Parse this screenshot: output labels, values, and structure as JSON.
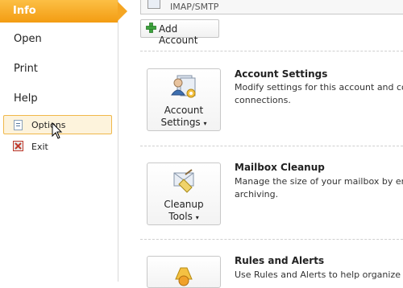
{
  "nav": {
    "info": "Info",
    "open": "Open",
    "print": "Print",
    "help": "Help",
    "options": "Options",
    "exit": "Exit"
  },
  "account": {
    "type_label": "IMAP/SMTP",
    "add_account": "Add Account"
  },
  "sections": [
    {
      "button_line1": "Account",
      "button_line2": "Settings",
      "title": "Account Settings",
      "desc_line1": "Modify settings for this account and conf",
      "desc_line2": "connections."
    },
    {
      "button_line1": "Cleanup",
      "button_line2": "Tools",
      "title": "Mailbox Cleanup",
      "desc_line1": "Manage the size of your mailbox by empt",
      "desc_line2": "archiving."
    },
    {
      "title": "Rules and Alerts",
      "desc_line1": "Use Rules and Alerts to help organize you"
    }
  ],
  "colors": {
    "nav_active": "#f39c12",
    "hover_bg": "#fdf3dc",
    "hover_border": "#f0b84a"
  },
  "icons": [
    "add-icon",
    "account-settings-icon",
    "cleanup-tools-icon",
    "rules-alerts-icon",
    "options-icon",
    "exit-icon",
    "mouse-cursor-icon"
  ]
}
